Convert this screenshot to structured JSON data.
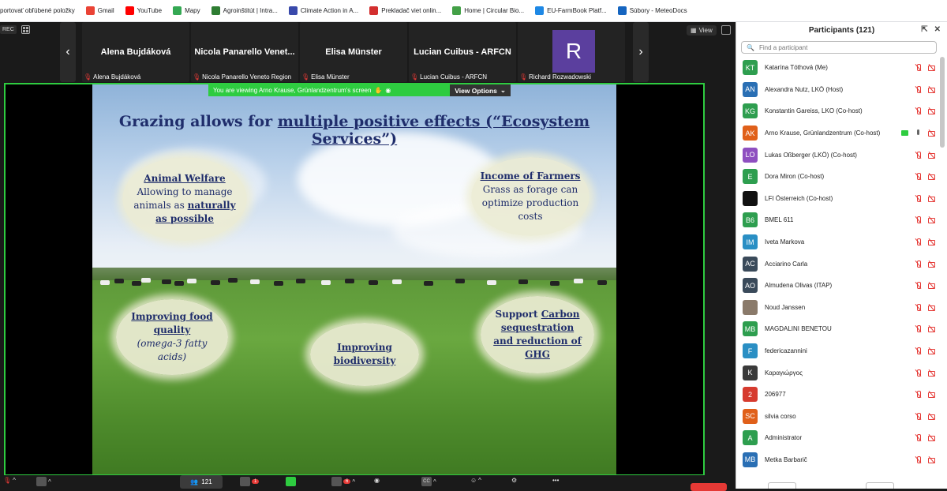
{
  "bookmarks": [
    {
      "label": "portovať obľúbené položky",
      "color": "#f2b400"
    },
    {
      "label": "Gmail",
      "color": "#ea4335"
    },
    {
      "label": "YouTube",
      "color": "#ff0000"
    },
    {
      "label": "Mapy",
      "color": "#34a853"
    },
    {
      "label": "Agroinštitút | Intra...",
      "color": "#2e7d32"
    },
    {
      "label": "Climate Action in A...",
      "color": "#3949ab"
    },
    {
      "label": "Prekladač viet onlin...",
      "color": "#d32f2f"
    },
    {
      "label": "Home | Circular Bio...",
      "color": "#43a047"
    },
    {
      "label": "EU-FarmBook Platf...",
      "color": "#1e88e5"
    },
    {
      "label": "Súbory - MeteoDocs",
      "color": "#1565c0"
    }
  ],
  "meeting": {
    "rec_label": "REC",
    "view_label": "View",
    "tiles": [
      {
        "name": "Alena Bujdáková",
        "caption": "Alena Bujdáková"
      },
      {
        "name": "Nicola Panarello Venet...",
        "caption": "Nicola Panarello Veneto Region"
      },
      {
        "name": "Elisa Münster",
        "caption": "Elisa Münster"
      },
      {
        "name": "Lucian Cuibus - ARFCN",
        "caption": "Lucian Cuibus - ARFCN"
      },
      {
        "name": "",
        "caption": "Richard Rozwadowski",
        "avatar_letter": "R"
      }
    ],
    "viewing_text": "You are viewing  Arno Krause, Grünlandzentrum's screen",
    "view_options": "View Options",
    "participants_count": "121",
    "chat_badge": "1",
    "reactions_badge": "6",
    "cc_label": "CC"
  },
  "slide": {
    "title_pre": "Grazing allows for ",
    "title_u": "multiple positive effects (“Ecosystem Services”)",
    "animal": {
      "h": "Animal Welfare",
      "l1": "Allowing to manage",
      "l2_pre": "animals as ",
      "l2_b": "naturally",
      "l3": "as possible"
    },
    "income": {
      "h": "Income of Farmers",
      "l1": "Grass as forage can",
      "l2": "optimize production",
      "l3": "costs"
    },
    "food": {
      "h1": "Improving food",
      "h2": "quality",
      "i1": "(omega-3 fatty",
      "i2": "acids)"
    },
    "biodiv": {
      "h1": "Improving",
      "h2": "biodiversity"
    },
    "carbon": {
      "l1_pre": "Support ",
      "l1_u": "Carbon",
      "l2": "sequestration",
      "l3": "and reduction of",
      "l4": "GHG"
    }
  },
  "panel": {
    "title": "Participants (121)",
    "search_placeholder": "Find a participant",
    "participants": [
      {
        "initials": "KT",
        "name": "Katarína Tóthová (Me)",
        "color": "#2e9e4f"
      },
      {
        "initials": "AN",
        "name": "Alexandra Nutz, LKÖ (Host)",
        "color": "#2a6fb4"
      },
      {
        "initials": "KG",
        "name": "Konstantin Gareiss, LKO (Co-host)",
        "color": "#2e9e4f"
      },
      {
        "initials": "AK",
        "name": "Arno Krause, Grünlandzentrum (Co-host)",
        "color": "#e0601a",
        "sharing": true
      },
      {
        "initials": "LO",
        "name": "Lukas Oßberger (LKÖ) (Co-host)",
        "color": "#8e4fc0"
      },
      {
        "initials": "E",
        "name": "Dora Miron (Co-host)",
        "color": "#2e9e4f"
      },
      {
        "initials": "",
        "name": "LFI Österreich (Co-host)",
        "color": "#111111"
      },
      {
        "initials": "B6",
        "name": "BMEL 611",
        "color": "#2e9e4f"
      },
      {
        "initials": "IM",
        "name": "Iveta Markova",
        "color": "#2a8fc4"
      },
      {
        "initials": "AC",
        "name": "Acciarino Carla",
        "color": "#3a4a5a"
      },
      {
        "initials": "AO",
        "name": "Almudena Olivas (ITAP)",
        "color": "#3a4a5a"
      },
      {
        "initials": "",
        "name": "Noud Janssen",
        "color": "#8a7a6a"
      },
      {
        "initials": "MB",
        "name": "MAGDALINI BENETOU",
        "color": "#2e9e4f"
      },
      {
        "initials": "F",
        "name": "federicazannini",
        "color": "#2a8fc4"
      },
      {
        "initials": "K",
        "name": "Καραγιώργος",
        "color": "#3a3a3a"
      },
      {
        "initials": "2",
        "name": "206977",
        "color": "#d63b2f"
      },
      {
        "initials": "SC",
        "name": "silvia corso",
        "color": "#e0601a"
      },
      {
        "initials": "A",
        "name": "Administrator",
        "color": "#2e9e4f"
      },
      {
        "initials": "MB",
        "name": "Metka Barbarič",
        "color": "#2a6fb4"
      }
    ]
  }
}
